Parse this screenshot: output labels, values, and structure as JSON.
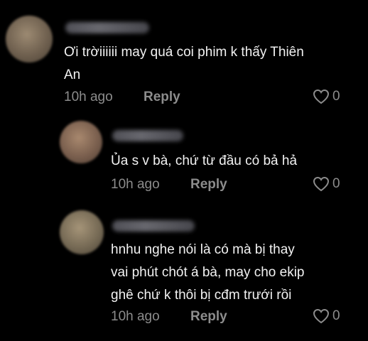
{
  "comments": [
    {
      "text": "Ơi trờiiiiii may quá coi phim k thấy Thiên\nAn",
      "time": "10h ago",
      "reply_label": "Reply",
      "likes": "0",
      "avatar_color": "#7a6a58"
    },
    {
      "text": "Ủa s v bà, chứ từ đầu có bả hả",
      "time": "10h ago",
      "reply_label": "Reply",
      "likes": "0",
      "avatar_color": "#8a6f5e"
    },
    {
      "text": "hnhu nghe nói là có mà bị thay\nvai phút chót á bà, may cho ekip\nghê chứ k thôi bị cđm trưới rồi",
      "time": "10h ago",
      "reply_label": "Reply",
      "likes": "0",
      "avatar_color": "#7e7460"
    }
  ],
  "colors": {
    "background": "#000000",
    "text": "#f2f2f2",
    "muted": "#8c8c8c"
  }
}
